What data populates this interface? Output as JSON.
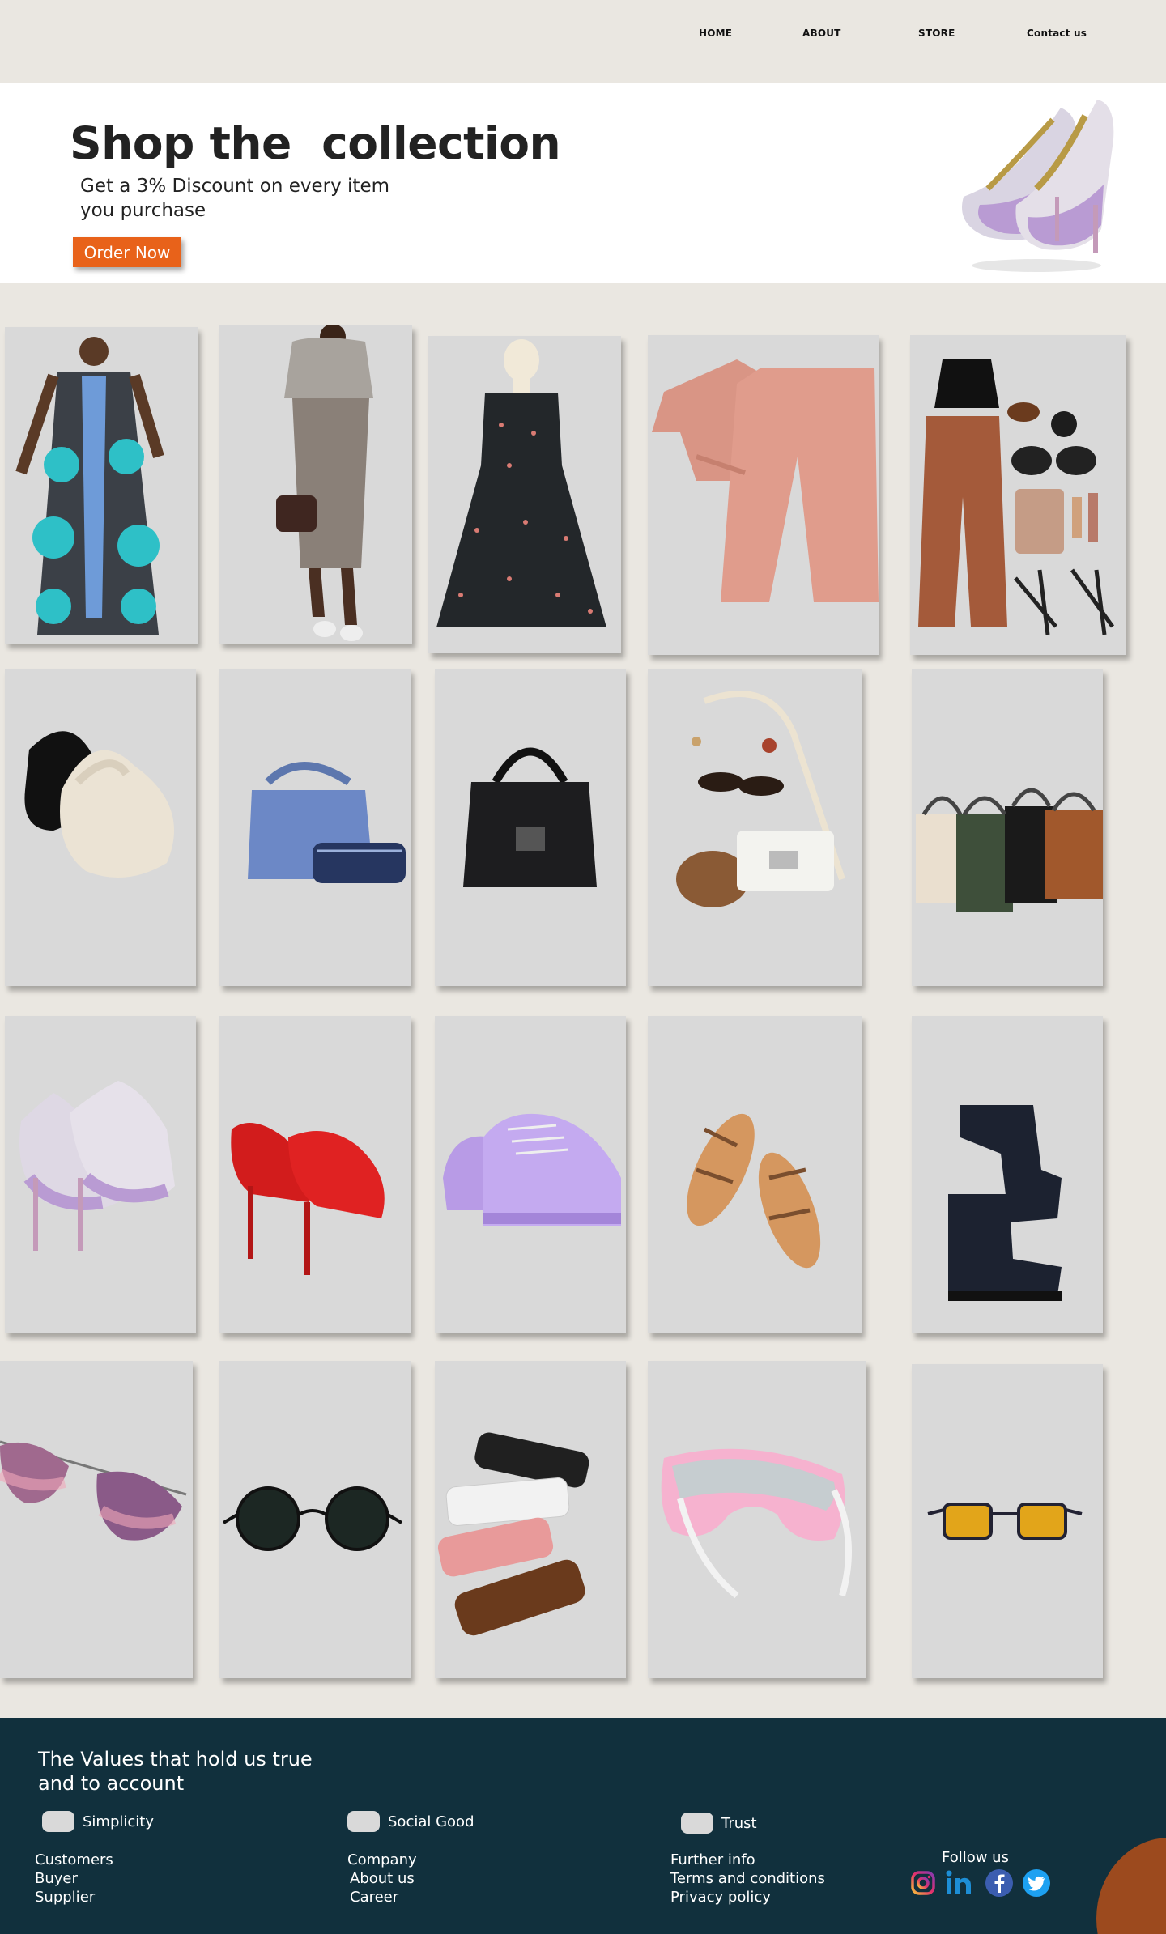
{
  "nav": {
    "items": [
      "HOME",
      "ABOUT",
      "STORE",
      "Contact us"
    ]
  },
  "hero": {
    "title": "Shop the  collection",
    "subtitle": "Get a 3% Discount on every item you purchase",
    "cta_label": "Order Now",
    "image_icon": "high-heel-shoe-icon"
  },
  "colors": {
    "page_bg": "#eae7e1",
    "hero_bg": "#ffffff",
    "card_bg": "#d9d9d9",
    "accent": "#e8621a",
    "footer_bg": "#11303d",
    "blob": "#9c4a1e"
  },
  "products": [
    {
      "name": "african-print-long-coat",
      "icon": "coat-icon"
    },
    {
      "name": "plaid-pencil-skirt-outfit",
      "icon": "skirt-outfit-icon"
    },
    {
      "name": "polka-dot-dress",
      "icon": "dress-icon"
    },
    {
      "name": "pink-two-piece-set",
      "icon": "two-piece-set-icon"
    },
    {
      "name": "brown-trousers-accessories-set",
      "icon": "outfit-set-icon"
    },
    {
      "name": "ruched-hobo-bags",
      "icon": "hobo-bag-icon"
    },
    {
      "name": "blue-handbag-clutch",
      "icon": "handbag-icon"
    },
    {
      "name": "black-croc-handbag",
      "icon": "handbag-icon"
    },
    {
      "name": "white-bag-accessories",
      "icon": "bag-accessories-icon"
    },
    {
      "name": "four-bucket-bags",
      "icon": "bucket-bag-icon"
    },
    {
      "name": "rhinestone-platform-heels",
      "icon": "heels-icon"
    },
    {
      "name": "red-suede-pumps",
      "icon": "pumps-icon"
    },
    {
      "name": "lilac-chunky-sneakers",
      "icon": "sneakers-icon"
    },
    {
      "name": "tan-strappy-sandals",
      "icon": "sandals-icon"
    },
    {
      "name": "black-chelsea-boots",
      "icon": "boots-icon"
    },
    {
      "name": "pink-cat-eye-sunglasses",
      "icon": "sunglasses-icon"
    },
    {
      "name": "round-black-sunglasses",
      "icon": "sunglasses-icon"
    },
    {
      "name": "four-retro-sunglasses",
      "icon": "sunglasses-icon"
    },
    {
      "name": "pink-sport-shield-glasses",
      "icon": "sport-glasses-icon"
    },
    {
      "name": "yellow-lens-glasses",
      "icon": "glasses-icon"
    }
  ],
  "footer": {
    "title": "The Values that hold us true and to account",
    "values": [
      "Simplicity",
      "Social Good",
      "Trust"
    ],
    "columns": [
      [
        "Customers",
        "Buyer",
        "Supplier"
      ],
      [
        "Company",
        "About us",
        "Career"
      ],
      [
        "Further info",
        "Terms and conditions",
        "Privacy policy"
      ]
    ],
    "follow_label": "Follow us",
    "social": [
      "instagram-icon",
      "linkedin-icon",
      "facebook-icon",
      "twitter-icon"
    ]
  }
}
